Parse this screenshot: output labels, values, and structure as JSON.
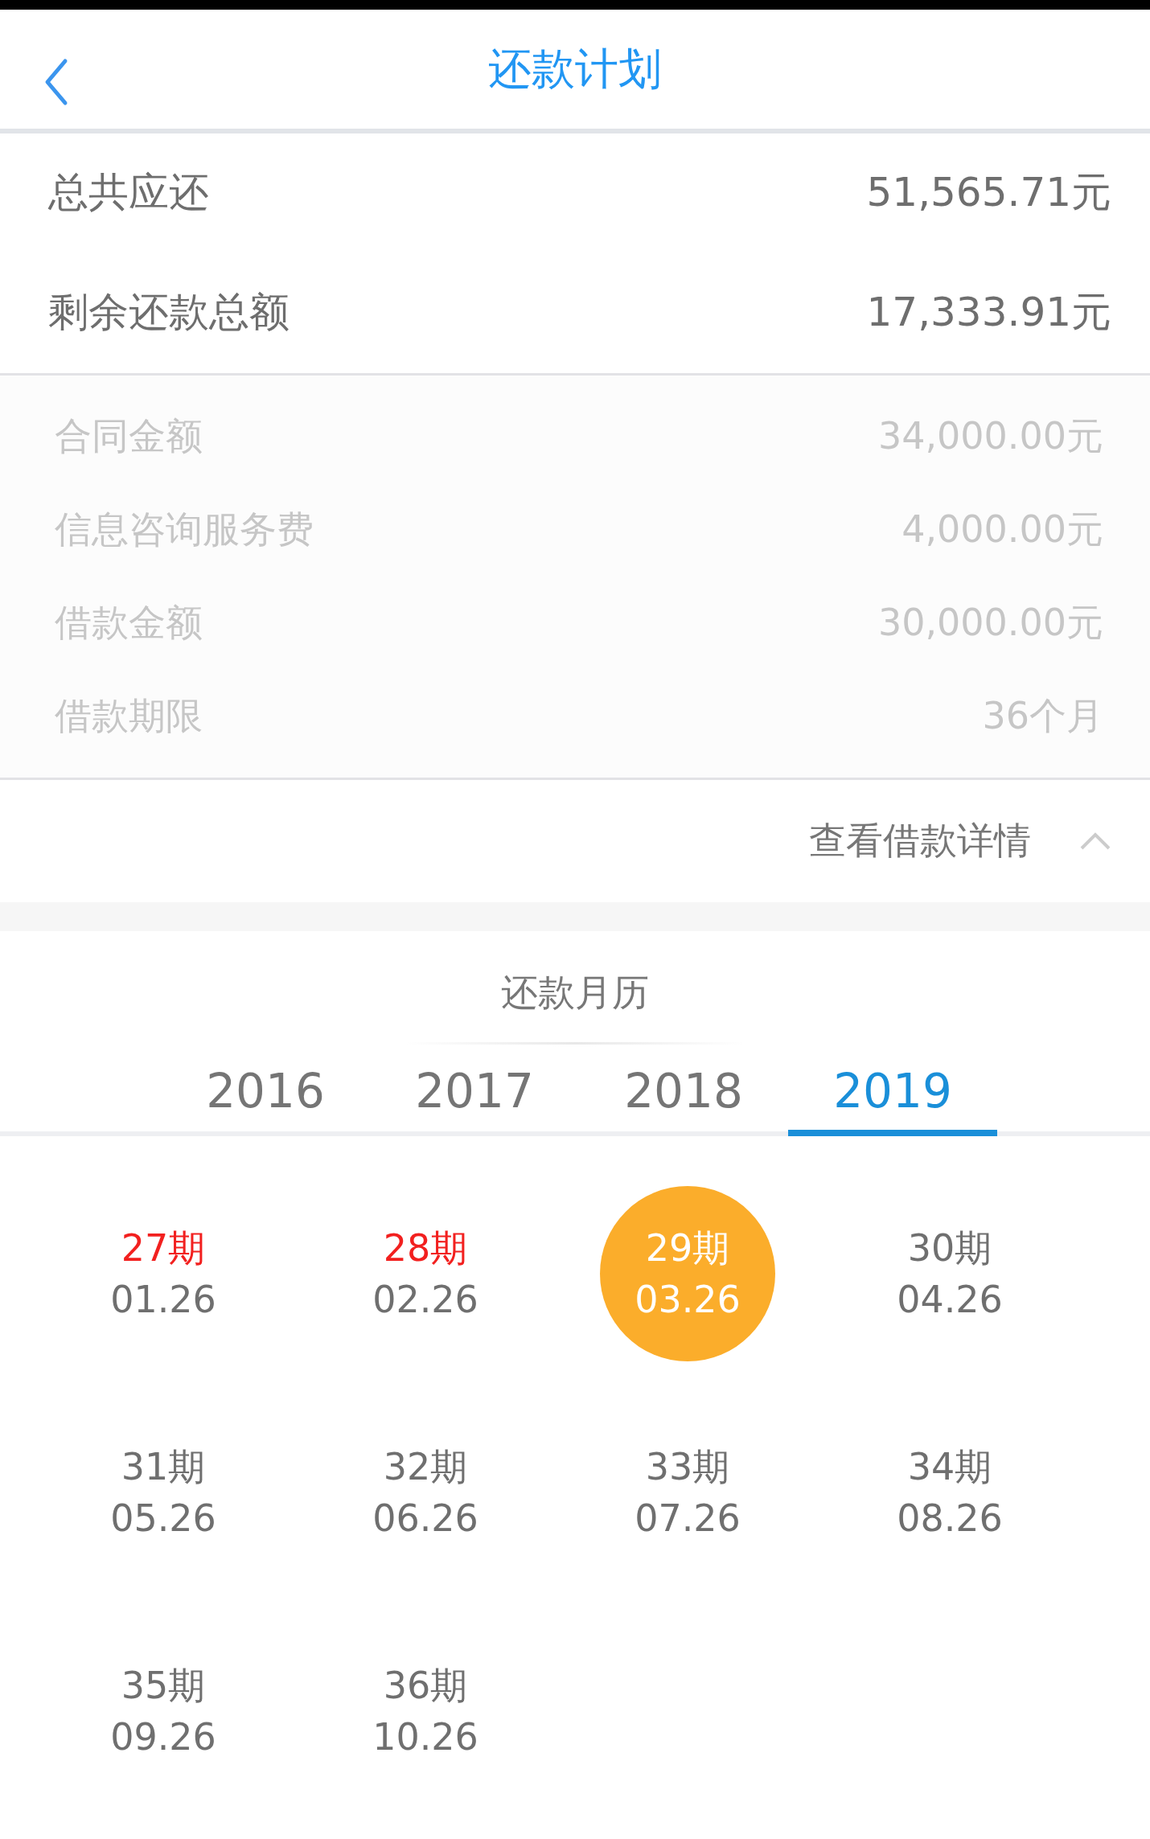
{
  "header": {
    "title": "还款计划"
  },
  "summary": [
    {
      "label": "总共应还",
      "value": "51,565.71元"
    },
    {
      "label": "剩余还款总额",
      "value": "17,333.91元"
    }
  ],
  "details": [
    {
      "label": "合同金额",
      "value": "34,000.00元"
    },
    {
      "label": "信息咨询服务费",
      "value": "4,000.00元"
    },
    {
      "label": "借款金额",
      "value": "30,000.00元"
    },
    {
      "label": "借款期限",
      "value": "36个月"
    }
  ],
  "details_toggle": {
    "label": "查看借款详情",
    "expanded": true
  },
  "calendar": {
    "title": "还款月历",
    "years": [
      {
        "label": "2016",
        "selected": false
      },
      {
        "label": "2017",
        "selected": false
      },
      {
        "label": "2018",
        "selected": false
      },
      {
        "label": "2019",
        "selected": true
      }
    ],
    "periods": [
      {
        "period": "27期",
        "date": "01.26",
        "overdue": true,
        "selected": false
      },
      {
        "period": "28期",
        "date": "02.26",
        "overdue": true,
        "selected": false
      },
      {
        "period": "29期",
        "date": "03.26",
        "overdue": false,
        "selected": true
      },
      {
        "period": "30期",
        "date": "04.26",
        "overdue": false,
        "selected": false
      },
      {
        "period": "31期",
        "date": "05.26",
        "overdue": false,
        "selected": false
      },
      {
        "period": "32期",
        "date": "06.26",
        "overdue": false,
        "selected": false
      },
      {
        "period": "33期",
        "date": "07.26",
        "overdue": false,
        "selected": false
      },
      {
        "period": "34期",
        "date": "08.26",
        "overdue": false,
        "selected": false
      },
      {
        "period": "35期",
        "date": "09.26",
        "overdue": false,
        "selected": false
      },
      {
        "period": "36期",
        "date": "10.26",
        "overdue": false,
        "selected": false
      }
    ]
  }
}
